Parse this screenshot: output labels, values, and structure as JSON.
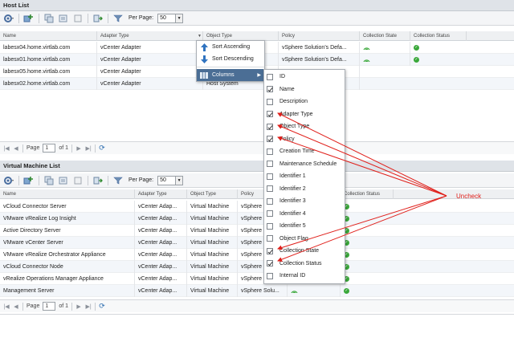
{
  "host_panel": {
    "title": "Host List",
    "per_page_label": "Per Page:",
    "per_page_value": "50",
    "columns": [
      "Name",
      "Adapter Type",
      "Object Type",
      "Policy",
      "Collection State",
      "Collection Status"
    ],
    "rows": [
      {
        "name": "labesx04.home.virtlab.com",
        "adapter": "vCenter Adapter",
        "object": "",
        "policy": "vSphere Solution's Defa..."
      },
      {
        "name": "labesx01.home.virtlab.com",
        "adapter": "vCenter Adapter",
        "object": "",
        "policy": "vSphere Solution's Defa..."
      },
      {
        "name": "labesx05.home.virtlab.com",
        "adapter": "vCenter Adapter",
        "object": "",
        "policy": ""
      },
      {
        "name": "labesx02.home.virtlab.com",
        "adapter": "vCenter Adapter",
        "object": "Host System",
        "policy": ""
      }
    ],
    "pager": {
      "page_label": "Page",
      "page_value": "1",
      "of_label": "of 1"
    }
  },
  "vm_panel": {
    "title": "Virtual Machine List",
    "per_page_label": "Per Page:",
    "per_page_value": "50",
    "columns": [
      "Name",
      "Adapter Type",
      "Object Type",
      "Policy",
      "",
      "Collection Status"
    ],
    "rows": [
      {
        "name": "vCloud Connector Server",
        "adapter": "vCenter Adap...",
        "object": "Virtual Machine",
        "policy": "vSphere"
      },
      {
        "name": "VMware vRealize Log Insight",
        "adapter": "vCenter Adap...",
        "object": "Virtual Machine",
        "policy": "vSphere"
      },
      {
        "name": "Active Directory Server",
        "adapter": "vCenter Adap...",
        "object": "Virtual Machine",
        "policy": "vSphere"
      },
      {
        "name": "VMware vCenter Server",
        "adapter": "vCenter Adap...",
        "object": "Virtual Machine",
        "policy": "vSphere"
      },
      {
        "name": "VMware vRealize Orchestrator Appliance",
        "adapter": "vCenter Adap...",
        "object": "Virtual Machine",
        "policy": "vSphere"
      },
      {
        "name": "vCloud Connector Node",
        "adapter": "vCenter Adap...",
        "object": "Virtual Machine",
        "policy": "vSphere"
      },
      {
        "name": "vRealize Operations Manager Appliance",
        "adapter": "vCenter Adap...",
        "object": "Virtual Machine",
        "policy": "vSphere Solu..."
      },
      {
        "name": "Management Server",
        "adapter": "vCenter Adap...",
        "object": "Virtual Machine",
        "policy": "vSphere Solu..."
      }
    ],
    "pager": {
      "page_label": "Page",
      "page_value": "1",
      "of_label": "of 1"
    }
  },
  "sort_menu": {
    "ascending": "Sort Ascending",
    "descending": "Sort Descending",
    "columns": "Columns"
  },
  "columns_menu": {
    "items": [
      {
        "label": "ID",
        "checked": false
      },
      {
        "label": "Name",
        "checked": true
      },
      {
        "label": "Description",
        "checked": false
      },
      {
        "label": "Adapter Type",
        "checked": true
      },
      {
        "label": "Object Type",
        "checked": true
      },
      {
        "label": "Policy",
        "checked": true
      },
      {
        "label": "Creation Time",
        "checked": false
      },
      {
        "label": "Maintenance Schedule",
        "checked": false
      },
      {
        "label": "Identifier 1",
        "checked": false
      },
      {
        "label": "Identifier 2",
        "checked": false
      },
      {
        "label": "Identifier 3",
        "checked": false
      },
      {
        "label": "Identifier 4",
        "checked": false
      },
      {
        "label": "Identifier 5",
        "checked": false
      },
      {
        "label": "Object Flag",
        "checked": false
      },
      {
        "label": "Collection State",
        "checked": true
      },
      {
        "label": "Collection Status",
        "checked": true
      },
      {
        "label": "Internal ID",
        "checked": false
      }
    ]
  },
  "annotation": {
    "text": "Uncheck",
    "color": "#e0201b"
  },
  "colors": {
    "header_bg": "#dfe3e8",
    "menu_active": "#4b6e95",
    "status_green": "#3aa83a"
  },
  "icons": [
    "gear-icon",
    "add-icon",
    "copy-icon",
    "edit-icon",
    "delete-icon",
    "move-icon",
    "filter-icon",
    "sort-ascending-icon",
    "sort-descending-icon",
    "columns-icon",
    "refresh-icon",
    "first-page-icon",
    "prev-page-icon",
    "next-page-icon",
    "last-page-icon"
  ]
}
